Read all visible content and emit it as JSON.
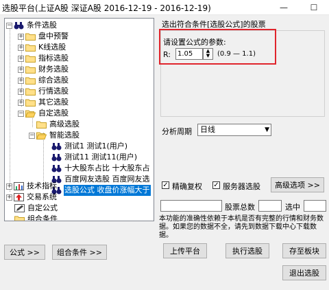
{
  "window": {
    "title": "选股平台(上证A股 深证A股   2016-12-19 - 2016-12-19)",
    "minimize": "—",
    "maximize": "☐"
  },
  "tree": {
    "root": "条件选股",
    "groups": [
      "盘中预警",
      "K线选股",
      "指标选股",
      "财务选股",
      "综合选股",
      "行情选股",
      "其它选股",
      "自定选股"
    ],
    "custom_children": [
      "高级选股",
      "智能选股"
    ],
    "smart_items": [
      "测试1 测试1(用户)",
      "测试11 测试11(用户)",
      "十大股东占比 十大股东占",
      "百度网友选股 百度网友选",
      "选股公式 收盘价涨幅大于"
    ],
    "other_roots": [
      "技术指标",
      "交易系统",
      "自定公式",
      "组合条件"
    ]
  },
  "buttons": {
    "formula": "公式 >>",
    "combo": "组合条件 >>",
    "advanced": "高级选项 >>",
    "upload": "上传平台",
    "execute": "执行选股",
    "save_block": "存至板块",
    "exit": "退出选股"
  },
  "panel": {
    "section_title": "选出符合条件[选股公式]的股票",
    "param_title": "请设置公式的参数:",
    "param_name": "R:",
    "param_value": "1.05",
    "param_range": "(0.9 — 1.1)"
  },
  "period": {
    "label": "分析周期",
    "value": "日线"
  },
  "options": {
    "exact_rights": "精确复权",
    "server_select": "服务器选股",
    "check_mark": "✓"
  },
  "status": {
    "total_label": "股票总数",
    "selected_label": "选中"
  },
  "notice": "本功能的准确性依赖于本机是否有完整的行情和财务数据。如果您的数据不全，请先到数据下载中心下载数据。"
}
